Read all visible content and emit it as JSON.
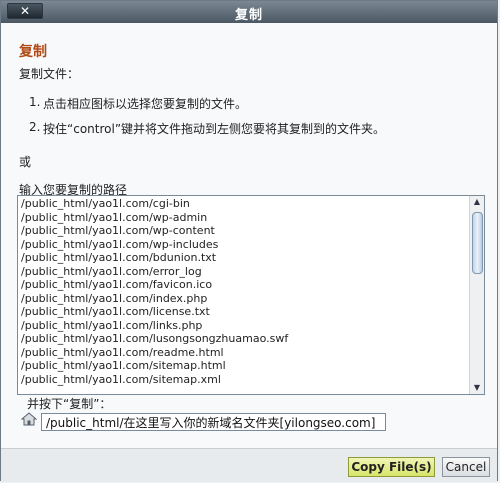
{
  "window": {
    "title": "复制",
    "close_label": "✕"
  },
  "dialog": {
    "heading": "复制",
    "subtitle": "复制文件：",
    "steps": [
      {
        "number": "1.",
        "text": "点击相应图标以选择您要复制的文件。"
      },
      {
        "number": "2.",
        "text": "按住“control”键并将文件拖动到左侧您要将其复制到的文件夹。"
      }
    ],
    "or_text": "或",
    "path_label": "输入您要复制的路径",
    "paths": [
      "/public_html/yao1l.com/cgi-bin",
      "/public_html/yao1l.com/wp-admin",
      "/public_html/yao1l.com/wp-content",
      "/public_html/yao1l.com/wp-includes",
      "/public_html/yao1l.com/bdunion.txt",
      "/public_html/yao1l.com/error_log",
      "/public_html/yao1l.com/favicon.ico",
      "/public_html/yao1l.com/index.php",
      "/public_html/yao1l.com/license.txt",
      "/public_html/yao1l.com/links.php",
      "/public_html/yao1l.com/lusongsongzhuamao.swf",
      "/public_html/yao1l.com/readme.html",
      "/public_html/yao1l.com/sitemap.html",
      "/public_html/yao1l.com/sitemap.xml"
    ],
    "press_label": "并按下“复制”：",
    "target_value": "/public_html/在这里写入你的新域名文件夹[yilongseo.com]"
  },
  "buttons": {
    "copy": "Copy File(s)",
    "cancel": "Cancel"
  }
}
